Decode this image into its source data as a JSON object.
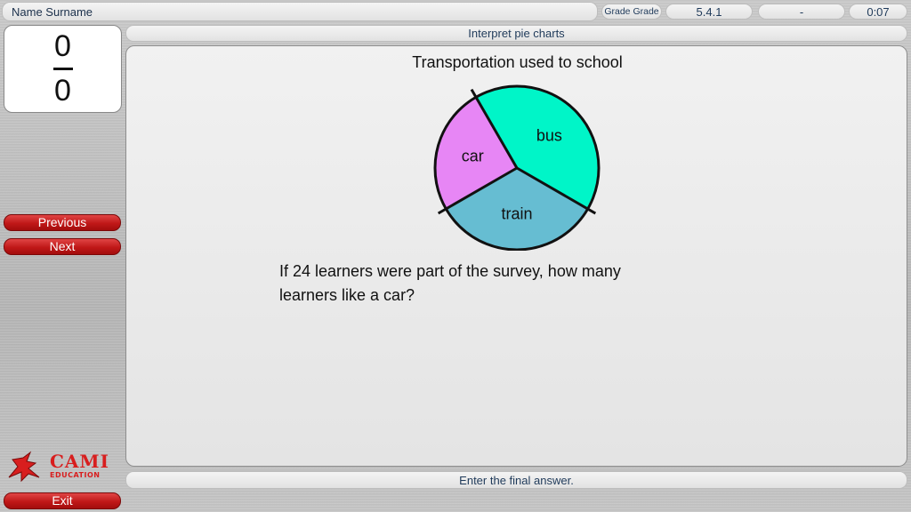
{
  "header": {
    "user_name": "Name Surname",
    "grade_label": "Grade Grade",
    "code": "5.4.1",
    "separator": "-",
    "timer": "0:07"
  },
  "score": {
    "numerator": "0",
    "denominator": "0"
  },
  "topic": "Interpret pie charts",
  "nav": {
    "previous": "Previous",
    "next": "Next",
    "exit": "Exit"
  },
  "logo": {
    "brand": "CAMI",
    "tagline": "EDUCATION"
  },
  "question": {
    "text": "If 24 learners were part of the survey, how many learners like a car?",
    "instruction": "Enter the final answer."
  },
  "chart_data": {
    "type": "pie",
    "title": "Transportation used to school",
    "slices": [
      {
        "label": "bus",
        "fraction": 0.4167,
        "color": "#00f5c8"
      },
      {
        "label": "train",
        "fraction": 0.3333,
        "color": "#66bdd2"
      },
      {
        "label": "car",
        "fraction": 0.25,
        "color": "#e786f5"
      }
    ]
  }
}
